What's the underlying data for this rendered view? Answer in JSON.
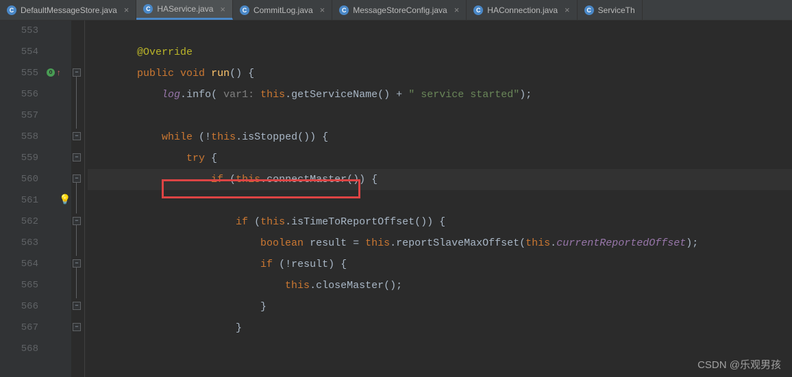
{
  "tabs": [
    {
      "name": "DefaultMessageStore.java",
      "active": false
    },
    {
      "name": "HAService.java",
      "active": true
    },
    {
      "name": "CommitLog.java",
      "active": false
    },
    {
      "name": "MessageStoreConfig.java",
      "active": false
    },
    {
      "name": "HAConnection.java",
      "active": false
    },
    {
      "name": "ServiceTh",
      "active": false,
      "truncated": true
    }
  ],
  "lineStart": 553,
  "lineEnd": 568,
  "code": {
    "l553": {
      "indent": "        "
    },
    "l554": {
      "indent": "        ",
      "ann": "@Override"
    },
    "l555": {
      "indent": "        ",
      "kw1": "public",
      "kw2": "void",
      "method": "run",
      "rest": "() {"
    },
    "l556": {
      "indent": "            ",
      "log": "log",
      "dot1": ".",
      "meth": "info",
      "p1": "(",
      "hint": " var1: ",
      "kw": "this",
      "d1": ".",
      "m1": "getServiceName",
      "m2": "() + ",
      "str": "\" service started\"",
      "end": ");"
    },
    "l557": {
      "indent": ""
    },
    "l558": {
      "indent": "            ",
      "kw1": "while",
      "p1": " (!",
      "kw2": "this",
      "d1": ".",
      "m1": "isStopped",
      "end": "()) {"
    },
    "l559": {
      "indent": "                ",
      "kw1": "try",
      "end": " {"
    },
    "l560": {
      "indent": "                    ",
      "kw1": "if",
      "p1": " (",
      "kw2": "this",
      "d1": ".",
      "m1": "connectMaster",
      "end": "()) {"
    },
    "l561": {
      "indent": ""
    },
    "l562": {
      "indent": "                        ",
      "kw1": "if",
      "p1": " (",
      "kw2": "this",
      "d1": ".",
      "m1": "isTimeToReportOffset",
      "end": "()) {"
    },
    "l563": {
      "indent": "                            ",
      "kw1": "boolean",
      "var": " result = ",
      "kw2": "this",
      "d1": ".",
      "m1": "reportSlaveMaxOffset",
      "p1": "(",
      "kw3": "this",
      "d2": ".",
      "field": "currentReportedOffset",
      "end": ");"
    },
    "l564": {
      "indent": "                            ",
      "kw1": "if",
      "end": " (!result) {"
    },
    "l565": {
      "indent": "                                ",
      "kw1": "this",
      "d1": ".",
      "m1": "closeMaster",
      "end": "();"
    },
    "l566": {
      "indent": "                            ",
      "end": "}"
    },
    "l567": {
      "indent": "                        ",
      "end": "}"
    },
    "l568": {
      "indent": ""
    }
  },
  "watermark": "CSDN @乐观男孩"
}
